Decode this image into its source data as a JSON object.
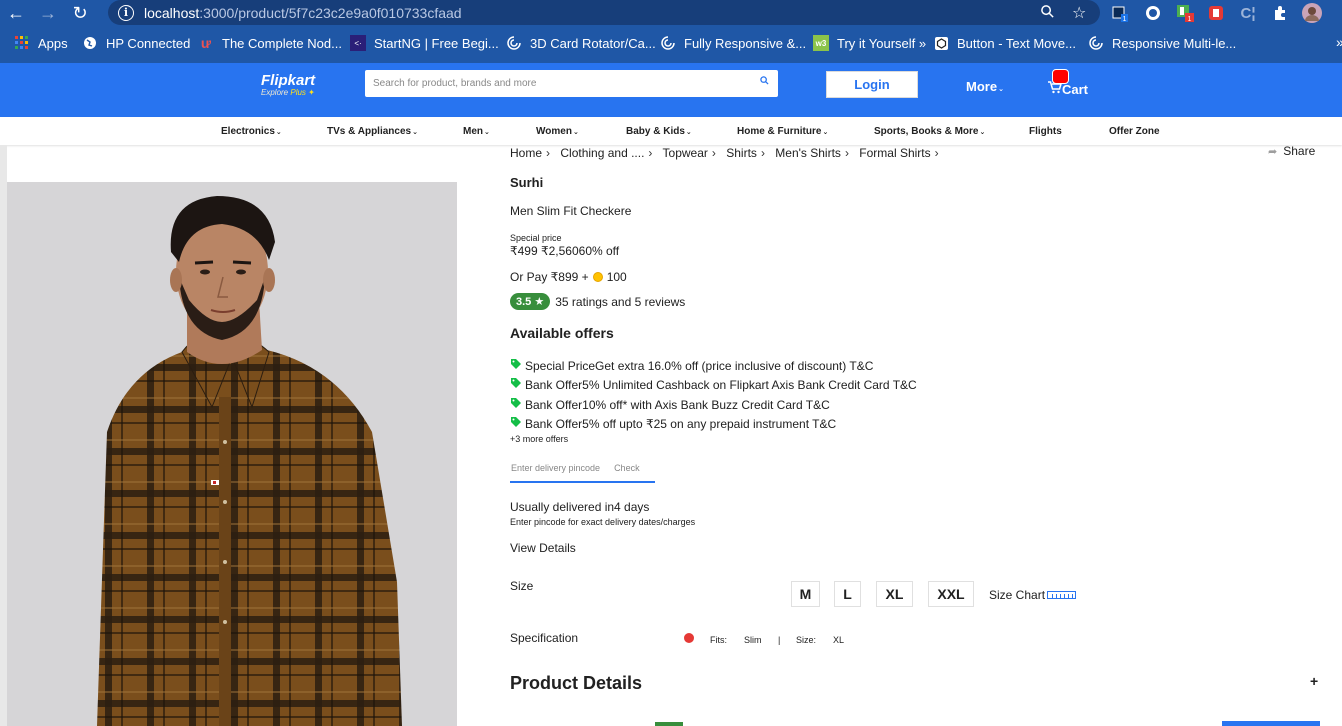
{
  "browser": {
    "url_host": "localhost",
    "url_path": ":3000/product/5f7c23c2e9a0f010733cfaad",
    "bookmarks": [
      {
        "label": "Apps",
        "icon": "apps-grid-icon"
      },
      {
        "label": "HP Connected",
        "icon": "globe-icon"
      },
      {
        "label": "The Complete Nod...",
        "icon": "udemy-icon"
      },
      {
        "label": "StartNG | Free Begi...",
        "icon": "startng-icon"
      },
      {
        "label": "3D Card Rotator/Ca...",
        "icon": "codepen-icon"
      },
      {
        "label": "Fully Responsive &...",
        "icon": "codepen-icon"
      },
      {
        "label": "Try it Yourself »",
        "icon": "w3schools-icon"
      },
      {
        "label": "Button - Text Move...",
        "icon": "codepen-box-icon"
      },
      {
        "label": "Responsive Multi-le...",
        "icon": "codepen-icon"
      }
    ],
    "ext_badge_1": "1",
    "ext_badge_2": "1"
  },
  "header": {
    "logo": "Flipkart",
    "logo_tag_explore": "Explore",
    "logo_tag_plus": "Plus",
    "search_placeholder": "Search for product, brands and more",
    "login": "Login",
    "more": "More",
    "cart": "Cart"
  },
  "categories": [
    {
      "label": "Electronics",
      "dropdown": true
    },
    {
      "label": "TVs & Appliances",
      "dropdown": true
    },
    {
      "label": "Men",
      "dropdown": true
    },
    {
      "label": "Women",
      "dropdown": true
    },
    {
      "label": "Baby & Kids",
      "dropdown": true
    },
    {
      "label": "Home & Furniture",
      "dropdown": true
    },
    {
      "label": "Sports, Books & More",
      "dropdown": true
    },
    {
      "label": "Flights",
      "dropdown": false
    },
    {
      "label": "Offer Zone",
      "dropdown": false
    }
  ],
  "breadcrumb": [
    "Home",
    "Clothing and ....",
    "Topwear",
    "Shirts",
    "Men's Shirts",
    "Formal Shirts"
  ],
  "share": "Share",
  "product": {
    "brand": "Surhi",
    "title": "Men Slim Fit Checkere",
    "special_price_label": "Special price",
    "price_line": "₹499 ₹2,56060% off",
    "or_pay_prefix": "Or Pay ₹899 +",
    "or_pay_coins": "100",
    "rating": "3.5 ★",
    "rating_text": "35 ratings and 5 reviews"
  },
  "offers": {
    "heading": "Available offers",
    "items": [
      "Special PriceGet extra 16.0% off (price inclusive of discount) T&C",
      "Bank Offer5% Unlimited Cashback on Flipkart Axis Bank Credit Card T&C",
      "Bank Offer10% off* with Axis Bank Buzz Credit Card T&C",
      "Bank Offer5% off upto ₹25 on any prepaid instrument T&C"
    ],
    "more": "+3 more offers"
  },
  "delivery": {
    "pincode_placeholder": "Enter delivery pincode",
    "check": "Check",
    "usually": "Usually delivered in4 days",
    "sub": "Enter pincode for exact delivery dates/charges",
    "view_details": "View Details"
  },
  "size": {
    "label": "Size",
    "options": [
      "M",
      "L",
      "XL",
      "XXL"
    ],
    "size_chart": "Size Chart"
  },
  "specification": {
    "label": "Specification",
    "fits_label": "Fits:",
    "fits_value": "Slim",
    "divider": "|",
    "size_label": "Size:",
    "size_value": "XL"
  },
  "product_details": {
    "heading": "Product Details",
    "toggle": "+"
  },
  "colors": {
    "chrome": "#1f57a6",
    "brand_blue": "#2874f0",
    "rating_green": "#388e3c",
    "shirt_brown": "#7a4e1c"
  }
}
